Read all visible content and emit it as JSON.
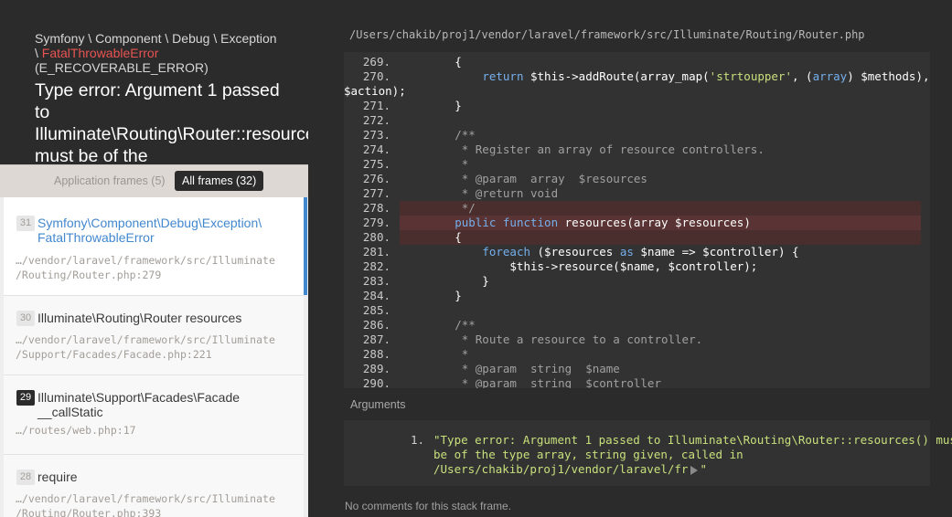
{
  "exception": {
    "class_prefix": "Symfony \\ Component \\ Debug \\ Exception \\ ",
    "class_name": "FatalThrowableError",
    "error_type": "(E_RECOVERABLE_ERROR)",
    "message_visible": "Type error: Argument 1 passed to Illuminate\\Routing\\Router::resources() must be of the"
  },
  "frame_filters": {
    "application": "Application frames (5)",
    "all": "All frames (32)"
  },
  "frames": [
    {
      "index": "31",
      "class": "Symfony\\Component\\Debug\\Exception\\ FatalThrowableError",
      "file": "…/vendor/laravel/framework/src/Illuminate /Routing/Router.php:279"
    },
    {
      "index": "30",
      "class": "Illuminate\\Routing\\Router resources",
      "file": "…/vendor/laravel/framework/src/Illuminate /Support/Facades/Facade.php:221"
    },
    {
      "index": "29",
      "class": "Illuminate\\Support\\Facades\\Facade __callStatic",
      "file": "…/routes/web.php:17"
    },
    {
      "index": "28",
      "class": "require",
      "file": "…/vendor/laravel/framework/src/Illuminate /Routing/Router.php:393"
    }
  ],
  "code": {
    "file_path": "/Users/chakib/proj1/vendor/laravel/framework/src/Illuminate/Routing/Router.php",
    "lines": [
      {
        "n": "269.",
        "t": "        {"
      },
      {
        "n": "270.",
        "t": "            return $this->addRoute(array_map('strtoupper', (array) $methods), $uri,"
      },
      {
        "n": "",
        "t": "$action);"
      },
      {
        "n": "271.",
        "t": "        }"
      },
      {
        "n": "272.",
        "t": ""
      },
      {
        "n": "273.",
        "t": "        /**"
      },
      {
        "n": "274.",
        "t": "         * Register an array of resource controllers."
      },
      {
        "n": "275.",
        "t": "         *"
      },
      {
        "n": "276.",
        "t": "         * @param  array  $resources"
      },
      {
        "n": "277.",
        "t": "         * @return void"
      },
      {
        "n": "278.",
        "t": "         */"
      },
      {
        "n": "279.",
        "t": "        public function resources(array $resources)"
      },
      {
        "n": "280.",
        "t": "        {"
      },
      {
        "n": "281.",
        "t": "            foreach ($resources as $name => $controller) {"
      },
      {
        "n": "282.",
        "t": "                $this->resource($name, $controller);"
      },
      {
        "n": "283.",
        "t": "            }"
      },
      {
        "n": "284.",
        "t": "        }"
      },
      {
        "n": "285.",
        "t": ""
      },
      {
        "n": "286.",
        "t": "        /**"
      },
      {
        "n": "287.",
        "t": "         * Route a resource to a controller."
      },
      {
        "n": "288.",
        "t": "         *"
      },
      {
        "n": "289.",
        "t": "         * @param  string  $name"
      },
      {
        "n": "290.",
        "t": "         * @param  string  $controller"
      }
    ]
  },
  "arguments": {
    "title": "Arguments",
    "items": [
      {
        "num": "1.",
        "line1": "\"Type error: Argument 1 passed to Illuminate\\Routing\\Router::resources() must",
        "line2": "be of the type array, string given, called in",
        "line3_before": "/Users/chakib/proj1/vendor/laravel/fr",
        "line3_after": "\""
      }
    ]
  },
  "comments_text": "No comments for this stack frame.",
  "colors": {
    "background": "#2b2b2b",
    "error_accent": "#e95353",
    "active_frame_accent": "#4288ce",
    "string": "#c7e07c",
    "keyword": "#75afec"
  }
}
